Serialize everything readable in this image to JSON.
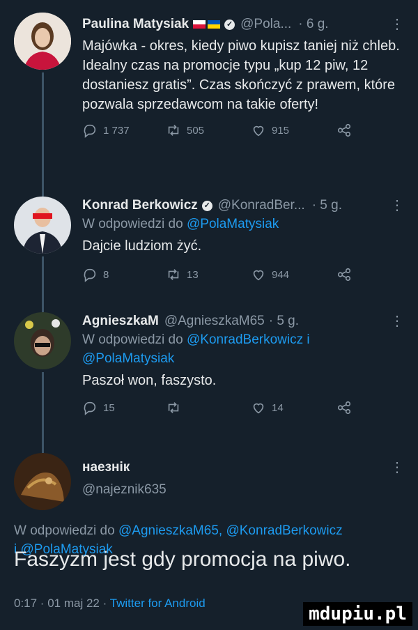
{
  "tweets": [
    {
      "name": "Paulina Matysiak",
      "handle": "@Pola...",
      "time": "· 6 g.",
      "text": "Majówka - okres, kiedy piwo kupisz taniej niż chleb. Idealny czas na promocje typu „kup 12 piw, 12 dostaniesz gratis”. Czas skończyć z prawem, które pozwala sprzedawcom na takie oferty!",
      "replies": "1 737",
      "retweets": "505",
      "likes": "915"
    },
    {
      "name": "Konrad Berkowicz",
      "handle": "@KonradBer...",
      "time": "· 5 g.",
      "reply_prefix": "W odpowiedzi do",
      "reply_to": "@PolaMatysiak",
      "text": "Dajcie ludziom żyć.",
      "replies": "8",
      "retweets": "13",
      "likes": "944"
    },
    {
      "name": "AgnieszkaM",
      "handle": "@AgnieszkaM65",
      "time": "· 5 g.",
      "reply_prefix": "W odpowiedzi do",
      "reply_to_1": "@KonradBerkowicz",
      "reply_and": "i",
      "reply_to_2": "@PolaMatysiak",
      "text": "Paszoł won, faszysto.",
      "replies": "15",
      "retweets": "",
      "likes": "14"
    }
  ],
  "main_tweet": {
    "name": "наезнік",
    "handle": "@najeznik635",
    "reply_prefix": "W odpowiedzi do",
    "reply_to_1": "@AgnieszkaM65,",
    "reply_to_2": "@KonradBerkowicz",
    "reply_and": "i",
    "reply_to_3": "@PolaMatysiak",
    "text": "Faszyzm jest gdy promocja na piwo.",
    "meta_time": "0:17 · 01 maj 22 ·",
    "meta_source": "Twitter for Android"
  },
  "icons": {
    "reply": "reply-icon",
    "retweet": "retweet-icon",
    "like": "heart-icon",
    "share": "share-icon",
    "more": "more-icon",
    "verified": "verified-icon"
  },
  "watermark": "mdupiu.pl"
}
